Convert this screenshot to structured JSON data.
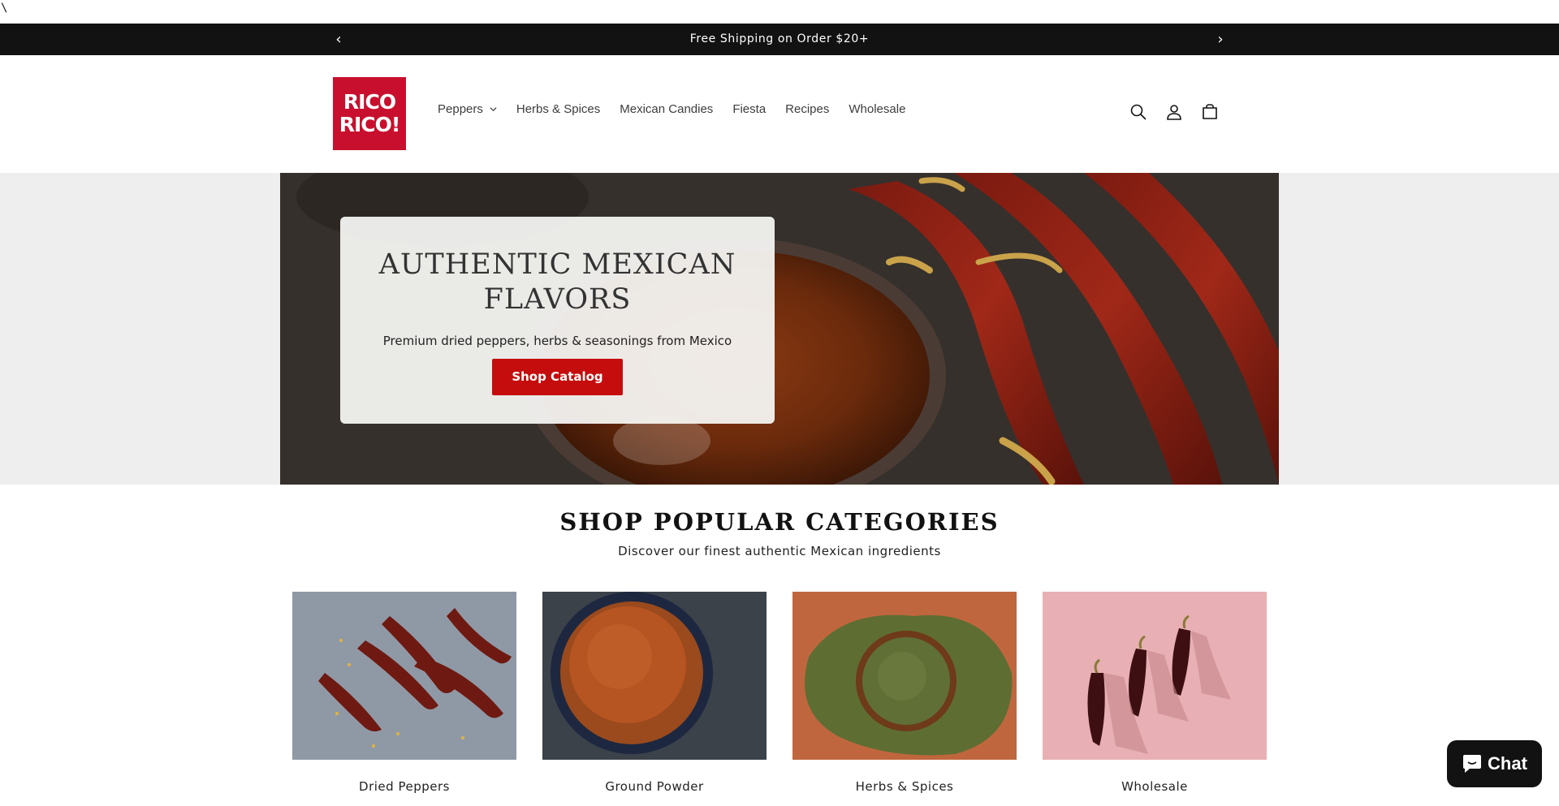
{
  "stray_text": "\\",
  "announcement": {
    "text": "Free Shipping on Order $20+",
    "prev_icon": "chevron-left-icon",
    "next_icon": "chevron-right-icon",
    "prev_glyph": "‹",
    "next_glyph": "›"
  },
  "header": {
    "logo_line1": "RICO",
    "logo_line2": "RICO!",
    "nav": [
      {
        "label": "Peppers",
        "has_dropdown": true
      },
      {
        "label": "Herbs & Spices"
      },
      {
        "label": "Mexican Candies"
      },
      {
        "label": "Fiesta"
      },
      {
        "label": "Recipes"
      },
      {
        "label": "Wholesale"
      }
    ],
    "icons": [
      "search-icon",
      "account-icon",
      "cart-icon"
    ]
  },
  "hero": {
    "title": "AUTHENTIC MEXICAN FLAVORS",
    "subtitle": "Premium dried peppers, herbs & seasonings from Mexico",
    "button": "Shop Catalog"
  },
  "categories": {
    "title": "SHOP POPULAR CATEGORIES",
    "subtitle": "Discover our finest authentic Mexican ingredients",
    "items": [
      {
        "label": "Dried Peppers"
      },
      {
        "label": "Ground Powder"
      },
      {
        "label": "Herbs & Spices"
      },
      {
        "label": "Wholesale"
      }
    ]
  },
  "chat": {
    "label": "Chat"
  },
  "colors": {
    "announcement_bg": "#121212",
    "logo_red": "#c8102e",
    "button_red": "#c50d0d"
  }
}
